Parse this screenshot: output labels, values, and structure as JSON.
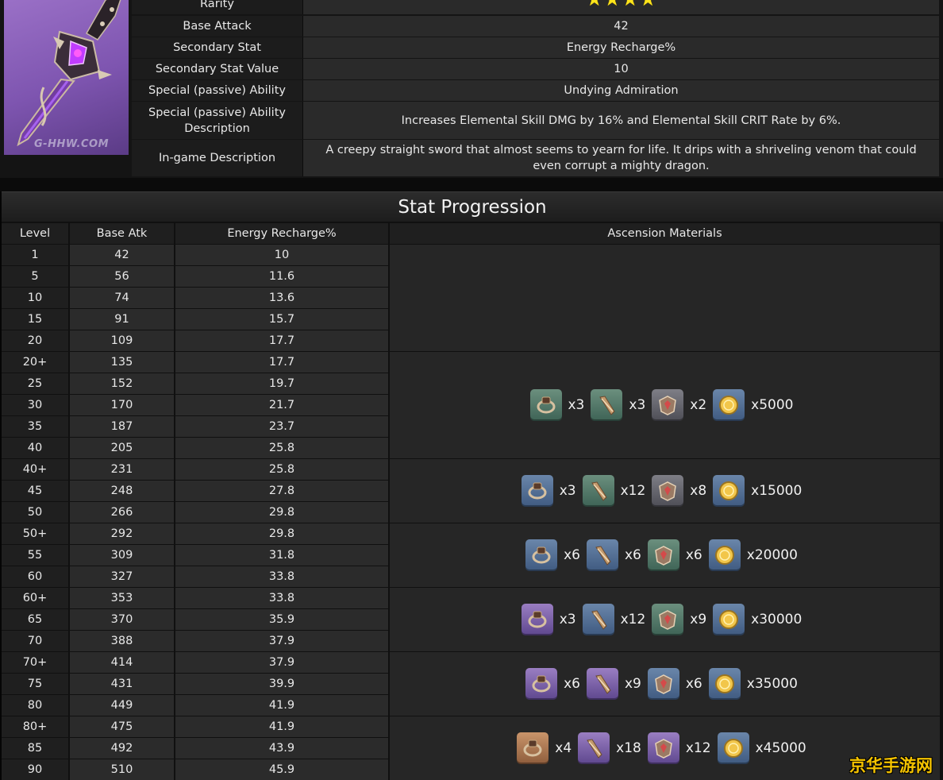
{
  "weapon": {
    "watermark": "G-HHW.COM",
    "rarity_stars": 4,
    "rows": [
      {
        "label": "Rarity",
        "value": ""
      },
      {
        "label": "Base Attack",
        "value": "42"
      },
      {
        "label": "Secondary Stat",
        "value": "Energy Recharge%"
      },
      {
        "label": "Secondary Stat Value",
        "value": "10"
      },
      {
        "label": "Special (passive) Ability",
        "value": "Undying Admiration"
      },
      {
        "label": "Special (passive) Ability Description",
        "value": "Increases Elemental Skill DMG by 16% and Elemental Skill CRIT Rate by 6%."
      },
      {
        "label": "In-game Description",
        "value": "A creepy straight sword that almost seems to yearn for life. It drips with a shriveling venom that could even corrupt a mighty dragon."
      }
    ],
    "colors": {
      "star": "#ffe51a",
      "image_bg": "#8a62bd"
    }
  },
  "progression": {
    "title": "Stat Progression",
    "headers": [
      "Level",
      "Base Atk",
      "Energy Recharge%",
      "Ascension Materials"
    ],
    "rows": [
      [
        "1",
        "42",
        "10"
      ],
      [
        "5",
        "56",
        "11.6"
      ],
      [
        "10",
        "74",
        "13.6"
      ],
      [
        "15",
        "91",
        "15.7"
      ],
      [
        "20",
        "109",
        "17.7"
      ],
      [
        "20+",
        "135",
        "17.7"
      ],
      [
        "25",
        "152",
        "19.7"
      ],
      [
        "30",
        "170",
        "21.7"
      ],
      [
        "35",
        "187",
        "23.7"
      ],
      [
        "40",
        "205",
        "25.8"
      ],
      [
        "40+",
        "231",
        "25.8"
      ],
      [
        "45",
        "248",
        "27.8"
      ],
      [
        "50",
        "266",
        "29.8"
      ],
      [
        "50+",
        "292",
        "29.8"
      ],
      [
        "55",
        "309",
        "31.8"
      ],
      [
        "60",
        "327",
        "33.8"
      ],
      [
        "60+",
        "353",
        "33.8"
      ],
      [
        "65",
        "370",
        "35.9"
      ],
      [
        "70",
        "388",
        "37.9"
      ],
      [
        "70+",
        "414",
        "37.9"
      ],
      [
        "75",
        "431",
        "39.9"
      ],
      [
        "80",
        "449",
        "41.9"
      ],
      [
        "80+",
        "475",
        "41.9"
      ],
      [
        "85",
        "492",
        "43.9"
      ],
      [
        "90",
        "510",
        "45.9"
      ]
    ],
    "ascensions": [
      {
        "materials": [
          {
            "icon": "ring-material-icon",
            "rarity": "green",
            "count": "x3"
          },
          {
            "icon": "horn-material-icon",
            "rarity": "green",
            "count": "x3"
          },
          {
            "icon": "insignia-material-icon",
            "rarity": "gray",
            "count": "x2"
          },
          {
            "icon": "mora-coin-icon",
            "rarity": "blue",
            "count": "x5000"
          }
        ]
      },
      {
        "materials": [
          {
            "icon": "ring-material-icon",
            "rarity": "blue",
            "count": "x3"
          },
          {
            "icon": "horn-material-icon",
            "rarity": "green",
            "count": "x12"
          },
          {
            "icon": "insignia-material-icon",
            "rarity": "gray",
            "count": "x8"
          },
          {
            "icon": "mora-coin-icon",
            "rarity": "blue",
            "count": "x15000"
          }
        ]
      },
      {
        "materials": [
          {
            "icon": "ring-material-icon",
            "rarity": "blue",
            "count": "x6"
          },
          {
            "icon": "horn-material-icon",
            "rarity": "blue",
            "count": "x6"
          },
          {
            "icon": "insignia-material-icon",
            "rarity": "green",
            "count": "x6"
          },
          {
            "icon": "mora-coin-icon",
            "rarity": "blue",
            "count": "x20000"
          }
        ]
      },
      {
        "materials": [
          {
            "icon": "ring-material-icon",
            "rarity": "purple",
            "count": "x3"
          },
          {
            "icon": "horn-material-icon",
            "rarity": "blue",
            "count": "x12"
          },
          {
            "icon": "insignia-material-icon",
            "rarity": "green",
            "count": "x9"
          },
          {
            "icon": "mora-coin-icon",
            "rarity": "blue",
            "count": "x30000"
          }
        ]
      },
      {
        "materials": [
          {
            "icon": "ring-material-icon",
            "rarity": "purple",
            "count": "x6"
          },
          {
            "icon": "horn-material-icon",
            "rarity": "purple",
            "count": "x9"
          },
          {
            "icon": "insignia-material-icon",
            "rarity": "blue",
            "count": "x6"
          },
          {
            "icon": "mora-coin-icon",
            "rarity": "blue",
            "count": "x35000"
          }
        ]
      },
      {
        "materials": [
          {
            "icon": "ring-material-icon",
            "rarity": "gold",
            "count": "x4"
          },
          {
            "icon": "horn-material-icon",
            "rarity": "purple",
            "count": "x18"
          },
          {
            "icon": "insignia-material-icon",
            "rarity": "purple",
            "count": "x12"
          },
          {
            "icon": "mora-coin-icon",
            "rarity": "blue",
            "count": "x45000"
          }
        ]
      }
    ]
  },
  "site_mark": "京华手游网"
}
